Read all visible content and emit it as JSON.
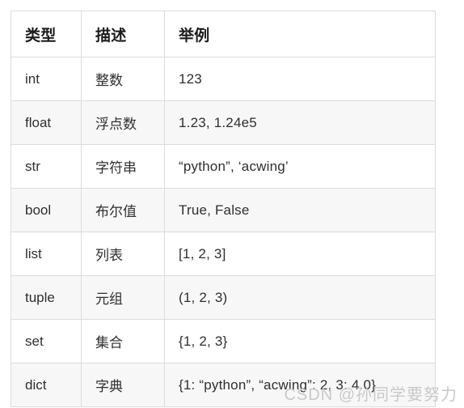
{
  "table": {
    "columns": [
      {
        "key": "type",
        "header": "类型"
      },
      {
        "key": "desc",
        "header": "描述"
      },
      {
        "key": "example",
        "header": "举例"
      }
    ],
    "rows": [
      {
        "type": "int",
        "desc": "整数",
        "example": "123"
      },
      {
        "type": "float",
        "desc": "浮点数",
        "example": "1.23, 1.24e5"
      },
      {
        "type": "str",
        "desc": "字符串",
        "example": "“python”, ‘acwing’"
      },
      {
        "type": "bool",
        "desc": "布尔值",
        "example": "True, False"
      },
      {
        "type": "list",
        "desc": "列表",
        "example": "[1, 2, 3]"
      },
      {
        "type": "tuple",
        "desc": "元组",
        "example": "(1, 2, 3)"
      },
      {
        "type": "set",
        "desc": "集合",
        "example": "{1, 2, 3}"
      },
      {
        "type": "dict",
        "desc": "字典",
        "example": "{1: “python”, “acwing”: 2, 3: 4.0}"
      }
    ]
  },
  "watermark": {
    "text": "CSDN @孙同学要努力",
    "color": "#c9c9c9"
  },
  "colors": {
    "page_background": "#ffffff",
    "border": "#dcdcdc",
    "row_stripe": "#f7f7f7",
    "header_text": "#1c1c1c",
    "body_text": "#2f2f2f"
  }
}
